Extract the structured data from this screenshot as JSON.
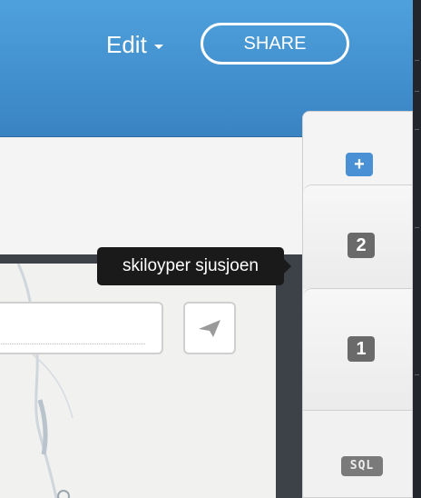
{
  "header": {
    "edit_label": "Edit",
    "share_label": "SHARE",
    "background": "#4a97d6"
  },
  "map": {
    "search_placeholder": ""
  },
  "layers_panel": {
    "add_label": "+",
    "layers": [
      {
        "number": "2",
        "tooltip": "skiloyper sjusjoen"
      },
      {
        "number": "1"
      }
    ],
    "sql_label": "SQL"
  },
  "tooltip": {
    "text": "skiloyper sjusjoen"
  }
}
